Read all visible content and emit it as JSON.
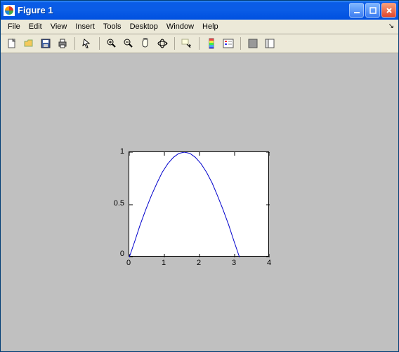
{
  "title": "Figure 1",
  "menu": {
    "file": "File",
    "edit": "Edit",
    "view": "View",
    "insert": "Insert",
    "tools": "Tools",
    "desktop": "Desktop",
    "windowm": "Window",
    "help": "Help"
  },
  "toolbar_icons": {
    "new": "new",
    "open": "open",
    "save": "save",
    "print": "print",
    "arrow": "arrow",
    "zoomin": "zoomin",
    "zoomout": "zoomout",
    "pan": "pan",
    "rotate": "rotate",
    "datacursor": "datacursor",
    "colorbar": "colorbar",
    "legend": "legend",
    "hidetools": "hidetools",
    "dock": "dock"
  },
  "chart_data": {
    "type": "line",
    "x": [
      0.0,
      0.16,
      0.31,
      0.47,
      0.63,
      0.79,
      0.94,
      1.1,
      1.26,
      1.41,
      1.57,
      1.73,
      1.88,
      2.04,
      2.2,
      2.36,
      2.51,
      2.67,
      2.83,
      2.98,
      3.14
    ],
    "y": [
      0.0,
      0.156,
      0.309,
      0.454,
      0.588,
      0.707,
      0.809,
      0.891,
      0.951,
      0.988,
      1.0,
      0.988,
      0.951,
      0.891,
      0.809,
      0.707,
      0.588,
      0.454,
      0.309,
      0.156,
      0.0
    ],
    "xlim": [
      0,
      4
    ],
    "ylim": [
      0,
      1
    ],
    "xticks": [
      0,
      1,
      2,
      3,
      4
    ],
    "yticks": [
      0,
      0.5,
      1
    ],
    "title": "",
    "xlabel": "",
    "ylabel": "",
    "line_color": "#0000cc"
  },
  "ticklabels": {
    "x0": "0",
    "x1": "1",
    "x2": "2",
    "x3": "3",
    "x4": "4",
    "y0": "0",
    "y1": "0.5",
    "y2": "1"
  }
}
